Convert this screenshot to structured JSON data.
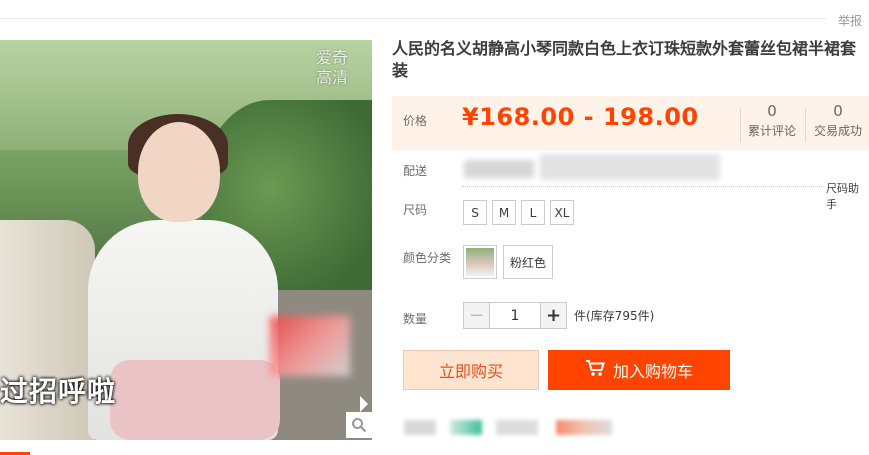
{
  "header": {
    "report": "举报"
  },
  "image": {
    "watermark_line1": "爱奇",
    "watermark_line2": "高清",
    "subtitle": "过招呼啦",
    "zoom_icon": "magnifier-icon"
  },
  "product": {
    "title": "人民的名义胡静高小琴同款白色上衣订珠短款外套蕾丝包裙半裙套装",
    "price_label": "价格",
    "price": "¥168.00 - 198.00",
    "reviews_count": "0",
    "reviews_label": "累计评论",
    "deals_count": "0",
    "deals_label": "交易成功",
    "shipping_label": "配送",
    "size_helper": "尺码助手",
    "size_label": "尺码",
    "sizes": [
      "S",
      "M",
      "L",
      "XL"
    ],
    "color_label": "颜色分类",
    "color_option": "粉红色",
    "qty_label": "数量",
    "qty_value": "1",
    "stock": "件(库存795件)",
    "buy_now": "立即购买",
    "add_to_cart": "加入购物车",
    "cart_icon": "shopping-cart-icon"
  },
  "colors": {
    "accent": "#ff4400",
    "price_bg": "#fff2e8",
    "buy_bg": "#ffe4d0"
  }
}
